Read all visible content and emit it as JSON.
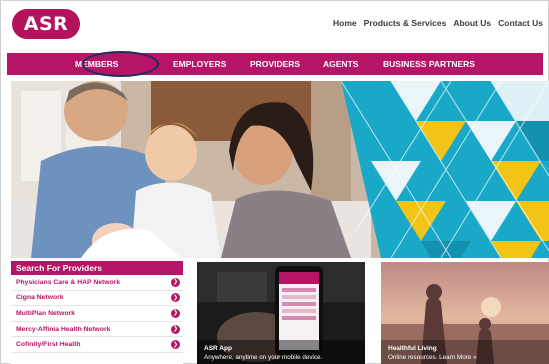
{
  "header": {
    "logo_text": "ASR",
    "top_links": [
      "Home",
      "Products & Services",
      "About Us",
      "Contact Us"
    ]
  },
  "nav": {
    "items": [
      "MEMBERS",
      "EMPLOYERS",
      "PROVIDERS",
      "AGENTS",
      "BUSINESS PARTNERS"
    ],
    "highlighted": "MEMBERS"
  },
  "providers": {
    "title": "Search For Providers",
    "items": [
      "Physicians Care & HAP Network",
      "Cigna Network",
      "MultiPlan Network",
      "Mercy-Affinia Health Network",
      "Cofinity/First Health"
    ]
  },
  "tiles": {
    "app": {
      "title": "ASR App",
      "subtitle": "Anywhere, anytime on your mobile device."
    },
    "living": {
      "title": "Healthful Living",
      "subtitle": "Online resources. Learn More »"
    }
  },
  "colors": {
    "brand": "#b61466",
    "nav_circle": "#1f2f5c",
    "pattern_teal": "#1aa8c9",
    "pattern_yellow": "#f2c418"
  }
}
